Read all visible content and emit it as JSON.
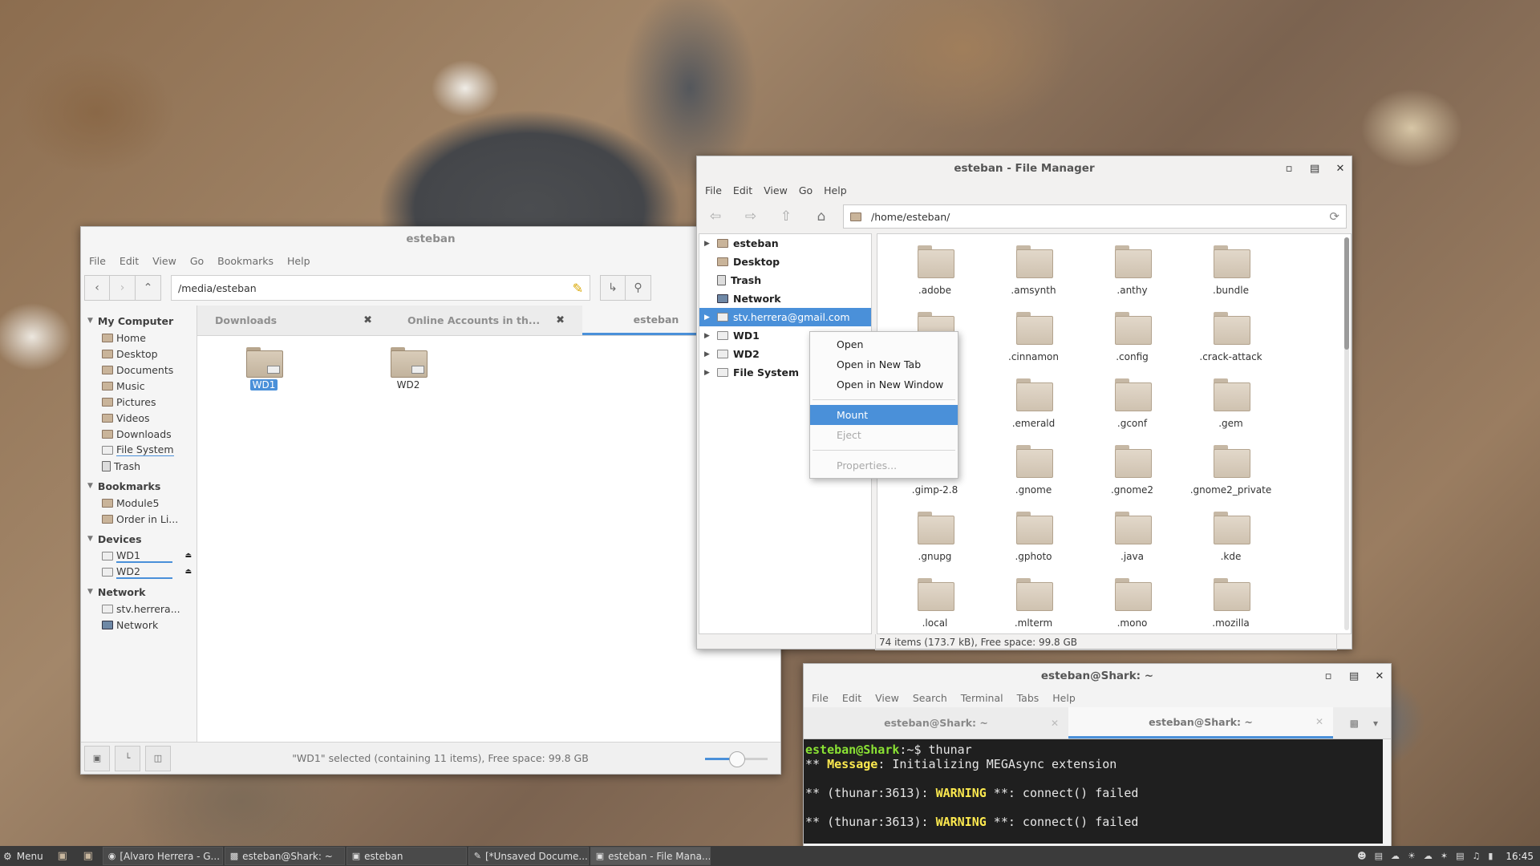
{
  "nemo": {
    "title": "esteban",
    "menu": [
      "File",
      "Edit",
      "View",
      "Go",
      "Bookmarks",
      "Help"
    ],
    "location": "/media/esteban",
    "sidebar": {
      "my_computer": "My Computer",
      "computer_items": [
        "Home",
        "Desktop",
        "Documents",
        "Music",
        "Pictures",
        "Videos",
        "Downloads",
        "File System",
        "Trash"
      ],
      "bookmarks": "Bookmarks",
      "bookmark_items": [
        "Module5",
        "Order in Li..."
      ],
      "devices": "Devices",
      "device_items": [
        "WD1",
        "WD2"
      ],
      "network": "Network",
      "network_items": [
        "stv.herrera...",
        "Network"
      ]
    },
    "tabs": [
      "Downloads",
      "Online Accounts in th...",
      "esteban"
    ],
    "files": [
      "WD1",
      "WD2"
    ],
    "status": "\"WD1\" selected (containing 11 items), Free space: 99.8 GB"
  },
  "thunar": {
    "title": "esteban - File Manager",
    "menu": [
      "File",
      "Edit",
      "View",
      "Go",
      "Help"
    ],
    "location": "/home/esteban/",
    "tree": [
      "esteban",
      "Desktop",
      "Trash",
      "Network",
      "stv.herrera@gmail.com",
      "WD1",
      "WD2",
      "File System"
    ],
    "items": [
      ".adobe",
      ".amsynth",
      ".anthy",
      ".bundle",
      "",
      ".cinnamon",
      ".config",
      ".crack-attack",
      "",
      ".emerald",
      ".gconf",
      ".gem",
      ".gimp-2.8",
      ".gnome",
      ".gnome2",
      ".gnome2_private",
      ".gnupg",
      ".gphoto",
      ".java",
      ".kde",
      ".local",
      ".mlterm",
      ".mono",
      ".mozilla"
    ],
    "status": "74 items (173.7 kB), Free space: 99.8 GB"
  },
  "context_menu": {
    "items": [
      "Open",
      "Open in New Tab",
      "Open in New Window",
      "Mount",
      "Eject",
      "Properties..."
    ]
  },
  "terminal": {
    "title": "esteban@Shark: ~",
    "menu": [
      "File",
      "Edit",
      "View",
      "Search",
      "Terminal",
      "Tabs",
      "Help"
    ],
    "tabs": [
      "esteban@Shark: ~",
      "esteban@Shark: ~"
    ],
    "prompt_user": "esteban@Shark",
    "prompt_dir": ":~",
    "prompt_sym": "$ thunar",
    "line1_prefix": "** ",
    "line1_msg": "Message",
    "line1_rest": ": Initializing MEGAsync extension",
    "warn_prefix": "** (thunar:3613): ",
    "warn_word": "WARNING",
    "warn_rest": " **: connect() failed"
  },
  "taskbar": {
    "menu_label": "Menu",
    "windows": [
      "[Alvaro Herrera - G...",
      "esteban@Shark: ~",
      "esteban",
      "[*Unsaved Docume...",
      "esteban - File Mana..."
    ],
    "clock": "16:45"
  }
}
